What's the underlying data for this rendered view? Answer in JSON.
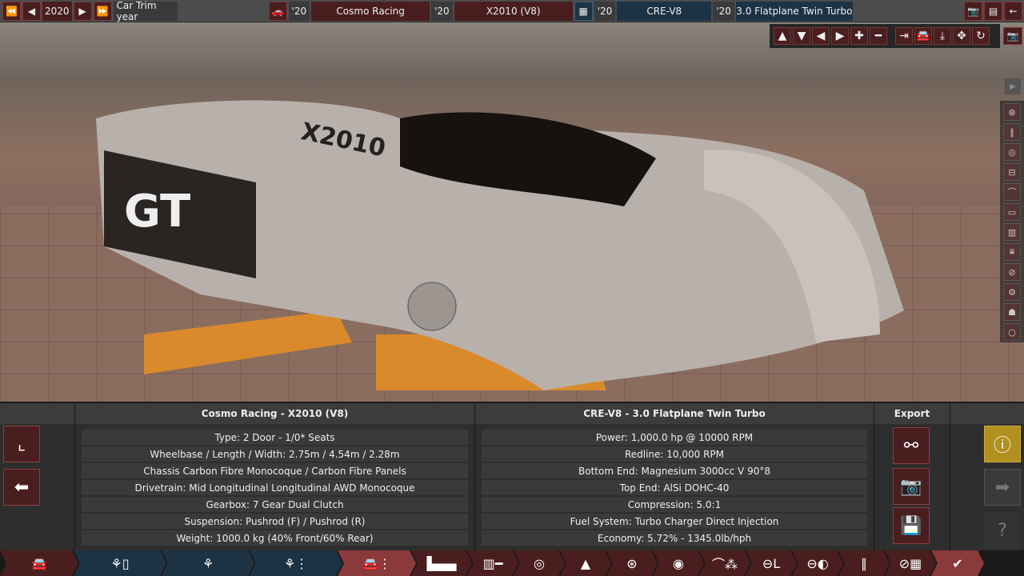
{
  "topbar": {
    "year": "2020",
    "trim_label": "Car Trim year",
    "model_year": "'20",
    "company": "Cosmo Racing",
    "trim_year": "'20",
    "trim": "X2010 (V8)",
    "family_year": "'20",
    "engine_family": "CRE-V8",
    "variant_year": "'20",
    "variant": "3.0 Flatplane Twin Turbo"
  },
  "car": {
    "decal_num": "X2010",
    "decal_gt": "GT"
  },
  "left_panel": {
    "title": "Cosmo Racing - X2010 (V8)",
    "rows": [
      "Type: 2 Door - 1/0* Seats",
      "Wheelbase / Length / Width: 2.75m / 4.54m / 2.28m",
      "Chassis Carbon Fibre Monocoque / Carbon Fibre Panels",
      "Drivetrain: Mid Longitudinal Longitudinal AWD Monocoque",
      "Gearbox: 7 Gear Dual Clutch",
      "Suspension: Pushrod (F) / Pushrod (R)",
      "Weight: 1000.0 kg (40% Front/60% Rear)"
    ]
  },
  "right_panel": {
    "title": "CRE-V8 - 3.0 Flatplane Twin Turbo",
    "rows": [
      "Power: 1,000.0 hp @ 10000 RPM",
      "Redline:  10,000 RPM",
      "Bottom End: Magnesium 3000cc V 90°8",
      "Top End: AlSi DOHC-40",
      "Compression: 5.0:1",
      "Fuel System: Turbo Charger Direct Injection",
      "Economy: 5.72% - 1345.0lb/hph"
    ]
  },
  "export": {
    "title": "Export"
  },
  "colors": {
    "red": "#4a1e1e",
    "blue": "#1c3346",
    "accent_red": "#8a3a3a",
    "warning": "#b09020"
  }
}
